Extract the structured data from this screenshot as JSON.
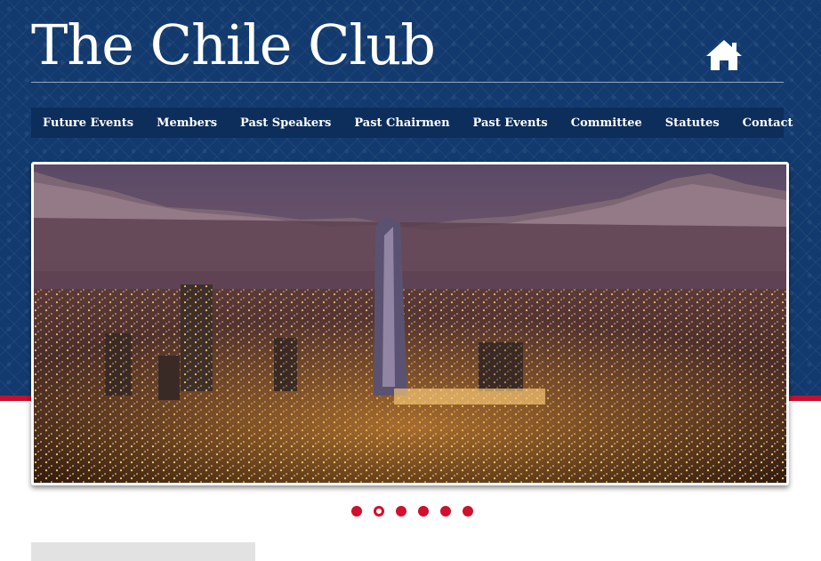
{
  "site": {
    "title": "The Chile Club",
    "home_icon": "home-icon"
  },
  "nav": {
    "items": [
      {
        "label": "Future Events"
      },
      {
        "label": "Members"
      },
      {
        "label": "Past Speakers"
      },
      {
        "label": "Past Chairmen"
      },
      {
        "label": "Past Events"
      },
      {
        "label": "Committee"
      },
      {
        "label": "Statutes"
      },
      {
        "label": "Contact"
      }
    ]
  },
  "slider": {
    "slide_count": 6,
    "active_slide": 2
  },
  "colors": {
    "header_background": "#123a6e",
    "nav_background": "#0d2d5a",
    "accent_red": "#c8102e"
  }
}
